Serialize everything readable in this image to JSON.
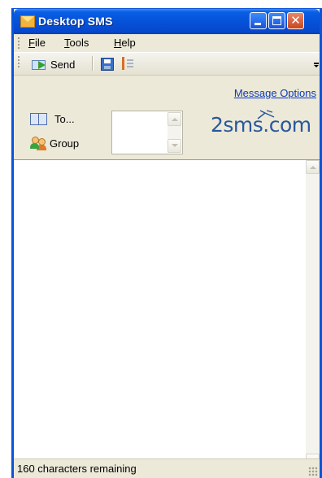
{
  "window": {
    "title": "Desktop SMS",
    "close_glyph": "✕"
  },
  "menu": {
    "file": {
      "hotkey": "F",
      "rest": "ile"
    },
    "tools": {
      "hotkey": "T",
      "rest": "ools"
    },
    "help": {
      "hotkey": "H",
      "rest": "elp"
    }
  },
  "toolbar": {
    "send_label": "Send"
  },
  "header": {
    "message_options": "Message Options",
    "to_label": "To...",
    "group_label": "Group",
    "logo": "2sms.com"
  },
  "message": {
    "text": ""
  },
  "status": {
    "characters_remaining": "160 characters remaining"
  },
  "colors": {
    "titlebar": "#0552d8",
    "link": "#0c3bb5",
    "logo": "#29579c"
  },
  "icons": [
    "envelope-icon",
    "minimize-icon",
    "maximize-icon",
    "close-icon",
    "send-icon",
    "save-icon",
    "list-icon",
    "address-book-icon",
    "group-icon",
    "logo-swoosh-icon",
    "resize-grip-icon"
  ]
}
